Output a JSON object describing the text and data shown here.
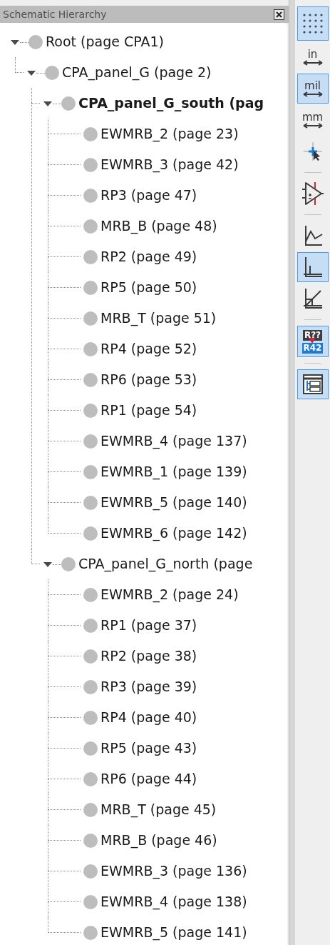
{
  "panel": {
    "title": "Schematic Hierarchy"
  },
  "tree": [
    {
      "label": "Root (page CPA1)",
      "current": false,
      "expanded": true,
      "children": [
        {
          "label": "CPA_panel_G (page 2)",
          "current": false,
          "expanded": true,
          "children": [
            {
              "label": "CPA_panel_G_south (pag",
              "current": true,
              "expanded": true,
              "children": [
                {
                  "label": "EWMRB_2 (page 23)",
                  "current": false
                },
                {
                  "label": "EWMRB_3 (page 42)",
                  "current": false
                },
                {
                  "label": "RP3 (page 47)",
                  "current": false
                },
                {
                  "label": "MRB_B (page 48)",
                  "current": false
                },
                {
                  "label": "RP2 (page 49)",
                  "current": false
                },
                {
                  "label": "RP5 (page 50)",
                  "current": false
                },
                {
                  "label": "MRB_T (page 51)",
                  "current": false
                },
                {
                  "label": "RP4 (page 52)",
                  "current": false
                },
                {
                  "label": "RP6 (page 53)",
                  "current": false
                },
                {
                  "label": "RP1 (page 54)",
                  "current": false
                },
                {
                  "label": "EWMRB_4 (page 137)",
                  "current": false
                },
                {
                  "label": "EWMRB_1 (page 139)",
                  "current": false
                },
                {
                  "label": "EWMRB_5 (page 140)",
                  "current": false
                },
                {
                  "label": "EWMRB_6 (page 142)",
                  "current": false
                }
              ]
            },
            {
              "label": "CPA_panel_G_north (page",
              "current": false,
              "expanded": true,
              "children": [
                {
                  "label": "EWMRB_2 (page 24)",
                  "current": false
                },
                {
                  "label": "RP1 (page 37)",
                  "current": false
                },
                {
                  "label": "RP2 (page 38)",
                  "current": false
                },
                {
                  "label": "RP3 (page 39)",
                  "current": false
                },
                {
                  "label": "RP4 (page 40)",
                  "current": false
                },
                {
                  "label": "RP5 (page 43)",
                  "current": false
                },
                {
                  "label": "RP6 (page 44)",
                  "current": false
                },
                {
                  "label": "MRB_T (page 45)",
                  "current": false
                },
                {
                  "label": "MRB_B (page 46)",
                  "current": false
                },
                {
                  "label": "EWMRB_3 (page 136)",
                  "current": false
                },
                {
                  "label": "EWMRB_4 (page 138)",
                  "current": false
                },
                {
                  "label": "EWMRB_5 (page 141)",
                  "current": false
                }
              ]
            }
          ]
        }
      ]
    }
  ],
  "toolbar": [
    {
      "kind": "grid",
      "selected": true
    },
    {
      "kind": "unit",
      "text": "in",
      "selected": false
    },
    {
      "kind": "unit",
      "text": "mil",
      "selected": true
    },
    {
      "kind": "unit",
      "text": "mm",
      "selected": false
    },
    {
      "kind": "cursor",
      "selected": false
    },
    {
      "kind": "separator"
    },
    {
      "kind": "opamp",
      "selected": false
    },
    {
      "kind": "separator"
    },
    {
      "kind": "free-angle",
      "selected": false
    },
    {
      "kind": "right-angle",
      "selected": true
    },
    {
      "kind": "angle-45",
      "selected": false
    },
    {
      "kind": "separator"
    },
    {
      "kind": "annotate",
      "top": "R??",
      "bottom": "R42",
      "selected": true
    },
    {
      "kind": "separator"
    },
    {
      "kind": "hierarchy",
      "selected": true
    }
  ]
}
